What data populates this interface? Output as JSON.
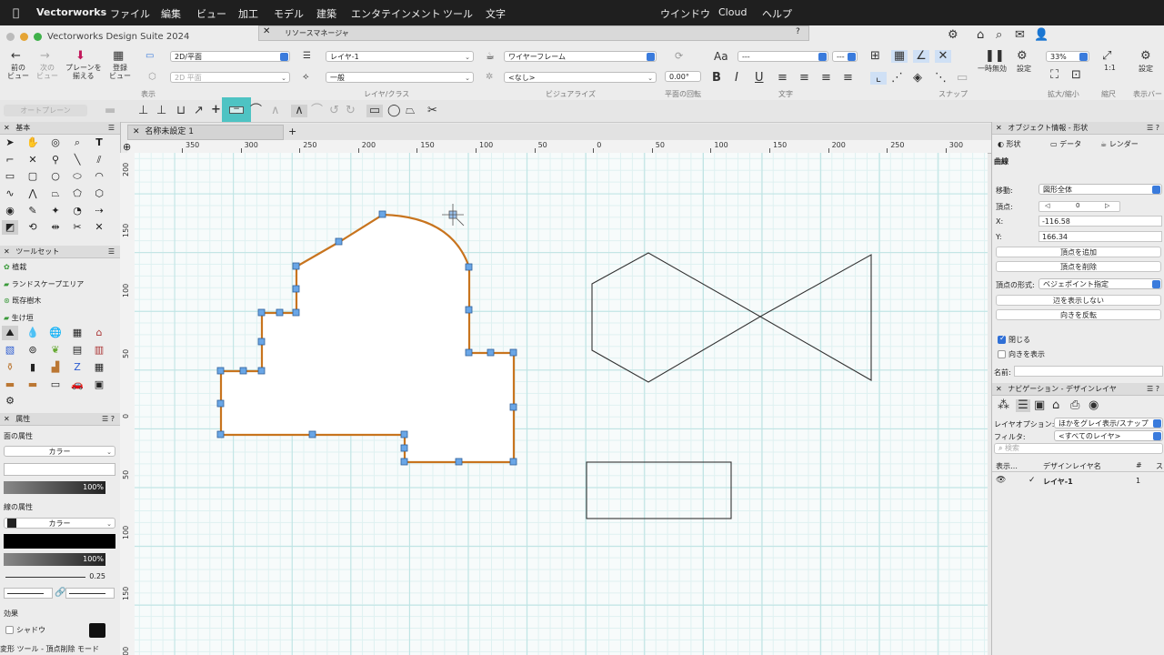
{
  "menubar": {
    "app": "Vectorworks",
    "items": [
      "ファイル",
      "編集",
      "ビュー",
      "加工",
      "モデル",
      "建築",
      "エンタテインメント",
      "ツール",
      "文字"
    ],
    "right_items": [
      "ウインドウ",
      "Cloud",
      "ヘルプ"
    ]
  },
  "window": {
    "title": "Vectorworks Design Suite 2024",
    "resource_manager": "リソースマネージャ",
    "help": "?"
  },
  "toolbar": {
    "prev_view": "前の\nビュー",
    "next_view": "次の\nビュー",
    "plane_align": "プレーンを\n揃える",
    "register_view": "登録\nビュー",
    "view_select": "2D/平面",
    "plane_select": "2D 平面",
    "display_label": "表示",
    "layer_select": "レイヤ-1",
    "class_select": "一般",
    "layer_class_label": "レイヤ/クラス",
    "render_select": "ワイヤーフレーム",
    "render_none": "<なし>",
    "visualize_label": "ビジュアライズ",
    "rotation_value": "0.00°",
    "rotation_label": "平面の回転",
    "font_select": "---",
    "font_size": "---",
    "text_label": "文字",
    "snap_label": "スナップ",
    "pause": "一時無効",
    "settings": "設定",
    "zoom_value": "33%",
    "zoom_label": "拡大/縮小",
    "scale_value": "1:1",
    "scale_label": "縮尺",
    "display_bar_label": "表示バー",
    "display_settings": "設定"
  },
  "modebar": {
    "auto_plane": "オートプレーン"
  },
  "left_panel": {
    "basic_title": "基本",
    "toolset_title": "ツールセット",
    "toolset_items": [
      "植栽",
      "ランドスケープエリア",
      "既存樹木",
      "生け垣"
    ],
    "attributes_title": "属性",
    "fill_label": "面の属性",
    "fill_type": "カラー",
    "fill_opacity": "100%",
    "line_label": "線の属性",
    "line_type": "カラー",
    "line_opacity": "100%",
    "line_weight": "0.25",
    "effects_label": "効果",
    "shadow_label": "シャドウ"
  },
  "document": {
    "tab_name": "名称未設定 1"
  },
  "rulers": {
    "top": [
      "350",
      "300",
      "250",
      "200",
      "150",
      "100",
      "50",
      "0",
      "50",
      "100",
      "150",
      "200",
      "250",
      "300"
    ],
    "left": [
      "200",
      "150",
      "100",
      "50",
      "0",
      "50",
      "100",
      "150",
      "200"
    ]
  },
  "object_info": {
    "title": "オブジェクト情報 - 形状",
    "tab_shape": "形状",
    "tab_data": "データ",
    "tab_render": "レンダー",
    "object_type": "曲線",
    "move_label": "移動:",
    "move_value": "図形全体",
    "vertex_label": "頂点:",
    "vertex_index": "0",
    "x_label": "X:",
    "x_value": "-116.58",
    "y_label": "Y:",
    "y_value": "166.34",
    "add_vertex": "頂点を追加",
    "delete_vertex": "頂点を削除",
    "vertex_type_label": "頂点の形式:",
    "vertex_type_value": "ベジェポイント指定",
    "hide_edge": "辺を表示しない",
    "reverse_dir": "向きを反転",
    "closed_label": "閉じる",
    "show_dir_label": "向きを表示",
    "name_label": "名前:"
  },
  "navigation": {
    "title": "ナビゲーション - デザインレイヤ",
    "layer_options_label": "レイヤオプション:",
    "layer_options_value": "ほかをグレイ表示/スナップ",
    "filter_label": "フィルタ:",
    "filter_value": "<すべてのレイヤ>",
    "search_placeholder": "検索",
    "col_visibility": "表示…",
    "col_name": "デザインレイヤ名",
    "col_number": "#",
    "col_s": "ス",
    "rows": [
      {
        "check": "✓",
        "name": "レイヤ-1",
        "number": "1"
      }
    ]
  },
  "status": {
    "text": "変形 ツール - 頂点削除 モード"
  },
  "colors": {
    "selection": "#c8741e",
    "handle": "#6aa6e6",
    "accent": "#3a7bdc",
    "highlight_tool": "#4ec3c3"
  }
}
